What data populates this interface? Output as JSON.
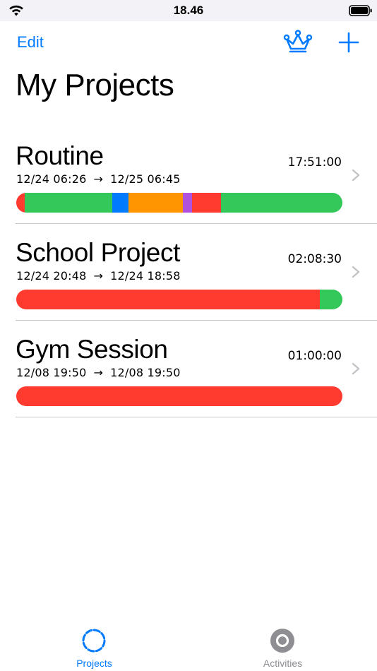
{
  "status": {
    "time": "18.46"
  },
  "nav": {
    "edit_label": "Edit"
  },
  "page_title": "My Projects",
  "projects": [
    {
      "name": "Routine",
      "start": "12/24 06:26",
      "end": "12/25 06:45",
      "duration": "17:51:00",
      "segments": [
        {
          "color": "#ff3b30",
          "fraction": 0.025
        },
        {
          "color": "#34c759",
          "fraction": 0.27
        },
        {
          "color": "#007aff",
          "fraction": 0.05
        },
        {
          "color": "#ff9500",
          "fraction": 0.165
        },
        {
          "color": "#af52de",
          "fraction": 0.03
        },
        {
          "color": "#ff3b30",
          "fraction": 0.088
        },
        {
          "color": "#34c759",
          "fraction": 0.372
        }
      ]
    },
    {
      "name": "School Project",
      "start": "12/24 20:48",
      "end": "12/24 18:58",
      "duration": "02:08:30",
      "segments": [
        {
          "color": "#ff3b30",
          "fraction": 0.93
        },
        {
          "color": "#34c759",
          "fraction": 0.07
        }
      ]
    },
    {
      "name": "Gym Session",
      "start": "12/08 19:50",
      "end": "12/08 19:50",
      "duration": "01:00:00",
      "segments": [
        {
          "color": "#ff3b30",
          "fraction": 1.0
        }
      ]
    }
  ],
  "tabs": [
    {
      "label": "Projects",
      "icon": "dashed-circle-icon",
      "active": true,
      "color": "#007aff"
    },
    {
      "label": "Activities",
      "icon": "ring-icon",
      "active": false,
      "color": "#8e8e93"
    }
  ],
  "colors": {
    "accent": "#007aff",
    "inactive": "#8e8e93",
    "divider": "#c8c8cc"
  }
}
